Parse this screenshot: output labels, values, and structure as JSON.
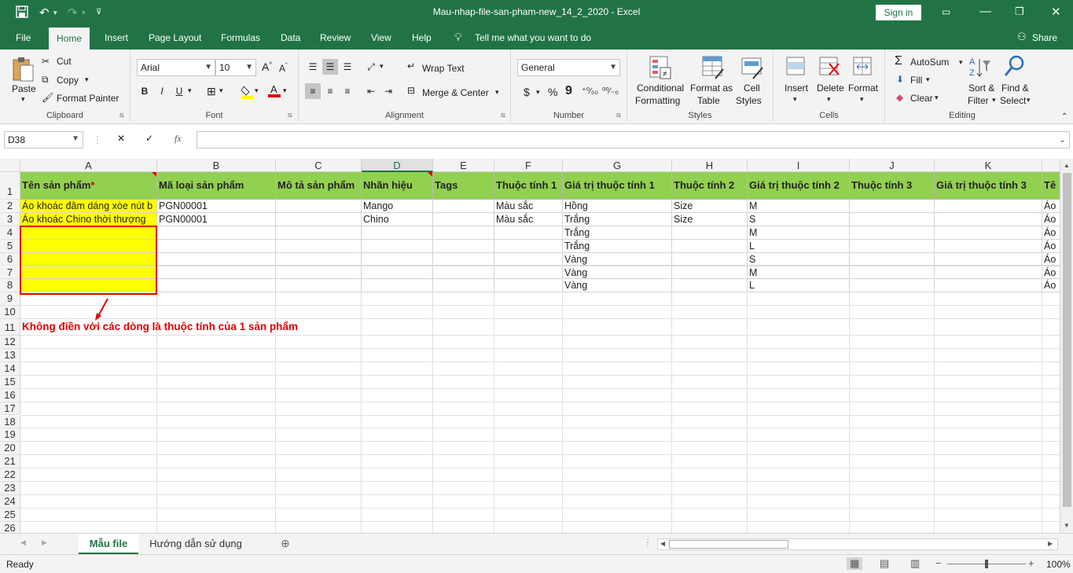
{
  "window": {
    "title": "Mau-nhap-file-san-pham-new_14_2_2020  -  Excel",
    "sign_in": "Sign in"
  },
  "tabs": [
    "File",
    "Home",
    "Insert",
    "Page Layout",
    "Formulas",
    "Data",
    "Review",
    "View",
    "Help"
  ],
  "tell_me": "Tell me what you want to do",
  "share": "Share",
  "ribbon": {
    "clipboard": {
      "paste": "Paste",
      "cut": "Cut",
      "copy": "Copy",
      "format_painter": "Format Painter",
      "label": "Clipboard"
    },
    "font": {
      "name": "Arial",
      "size": "10",
      "bold": "B",
      "italic": "I",
      "underline": "U",
      "label": "Font"
    },
    "alignment": {
      "wrap": "Wrap Text",
      "merge": "Merge & Center",
      "label": "Alignment"
    },
    "number": {
      "format": "General",
      "currency": "$",
      "percent": "%",
      "comma": "9",
      "label": "Number"
    },
    "styles": {
      "conditional_1": "Conditional",
      "conditional_2": "Formatting",
      "format_table_1": "Format as",
      "format_table_2": "Table",
      "cell_styles_1": "Cell",
      "cell_styles_2": "Styles",
      "label": "Styles"
    },
    "cells": {
      "insert": "Insert",
      "delete": "Delete",
      "format": "Format",
      "label": "Cells"
    },
    "editing": {
      "autosum": "AutoSum",
      "fill": "Fill",
      "clear": "Clear",
      "sort_1": "Sort &",
      "sort_2": "Filter",
      "find_1": "Find &",
      "find_2": "Select",
      "label": "Editing"
    }
  },
  "formula_bar": {
    "name_box": "D38",
    "fx": "fx",
    "value": ""
  },
  "columns": [
    "A",
    "B",
    "C",
    "D",
    "E",
    "F",
    "G",
    "H",
    "I",
    "J",
    "K"
  ],
  "row_numbers": [
    "1",
    "2",
    "3",
    "4",
    "5",
    "6",
    "7",
    "8",
    "9",
    "10",
    "11",
    "12",
    "13",
    "14",
    "15",
    "16",
    "17",
    "18",
    "19",
    "20",
    "21",
    "22",
    "23",
    "24",
    "25",
    "26"
  ],
  "headers": [
    "Tên sản phẩm",
    "Mã loại sản phẩm",
    "Mô tả sản phẩm",
    "Nhãn hiệu",
    "Tags",
    "Thuộc tính 1",
    "Giá trị thuộc tính 1",
    "Thuộc tính 2",
    "Giá trị thuộc tính 2",
    "Thuộc tính 3",
    "Giá trị thuộc tính 3",
    "Tê"
  ],
  "required_mark": "*",
  "rows": [
    [
      "Áo khoác đâm dáng xòe nút b",
      "PGN00001",
      "",
      "Mango",
      "",
      "Màu sắc",
      "Hồng",
      "Size",
      "M",
      "",
      "",
      "Áo"
    ],
    [
      "Áo khoác Chino thời thượng",
      "PGN00001",
      "",
      "Chino",
      "",
      "Màu sắc",
      "Trắng",
      "Size",
      "S",
      "",
      "",
      "Áo"
    ],
    [
      "",
      "",
      "",
      "",
      "",
      "",
      "Trắng",
      "",
      "M",
      "",
      "",
      "Áo"
    ],
    [
      "",
      "",
      "",
      "",
      "",
      "",
      "Trắng",
      "",
      "L",
      "",
      "",
      "Áo"
    ],
    [
      "",
      "",
      "",
      "",
      "",
      "",
      "Vàng",
      "",
      "S",
      "",
      "",
      "Áo"
    ],
    [
      "",
      "",
      "",
      "",
      "",
      "",
      "Vàng",
      "",
      "M",
      "",
      "",
      "Áo"
    ],
    [
      "",
      "",
      "",
      "",
      "",
      "",
      "Vàng",
      "",
      "L",
      "",
      "",
      "Áo"
    ]
  ],
  "annotation": "Không điền với các dòng là thuộc tính của 1 sản phẩm",
  "sheets": [
    "Mẫu file",
    "Hướng dẫn sử dụng"
  ],
  "status": {
    "ready": "Ready",
    "zoom": "100%"
  },
  "colors": {
    "excel_green": "#217346",
    "header_fill": "#92d050",
    "highlight": "#ffff00",
    "annotation": "#e00000"
  }
}
